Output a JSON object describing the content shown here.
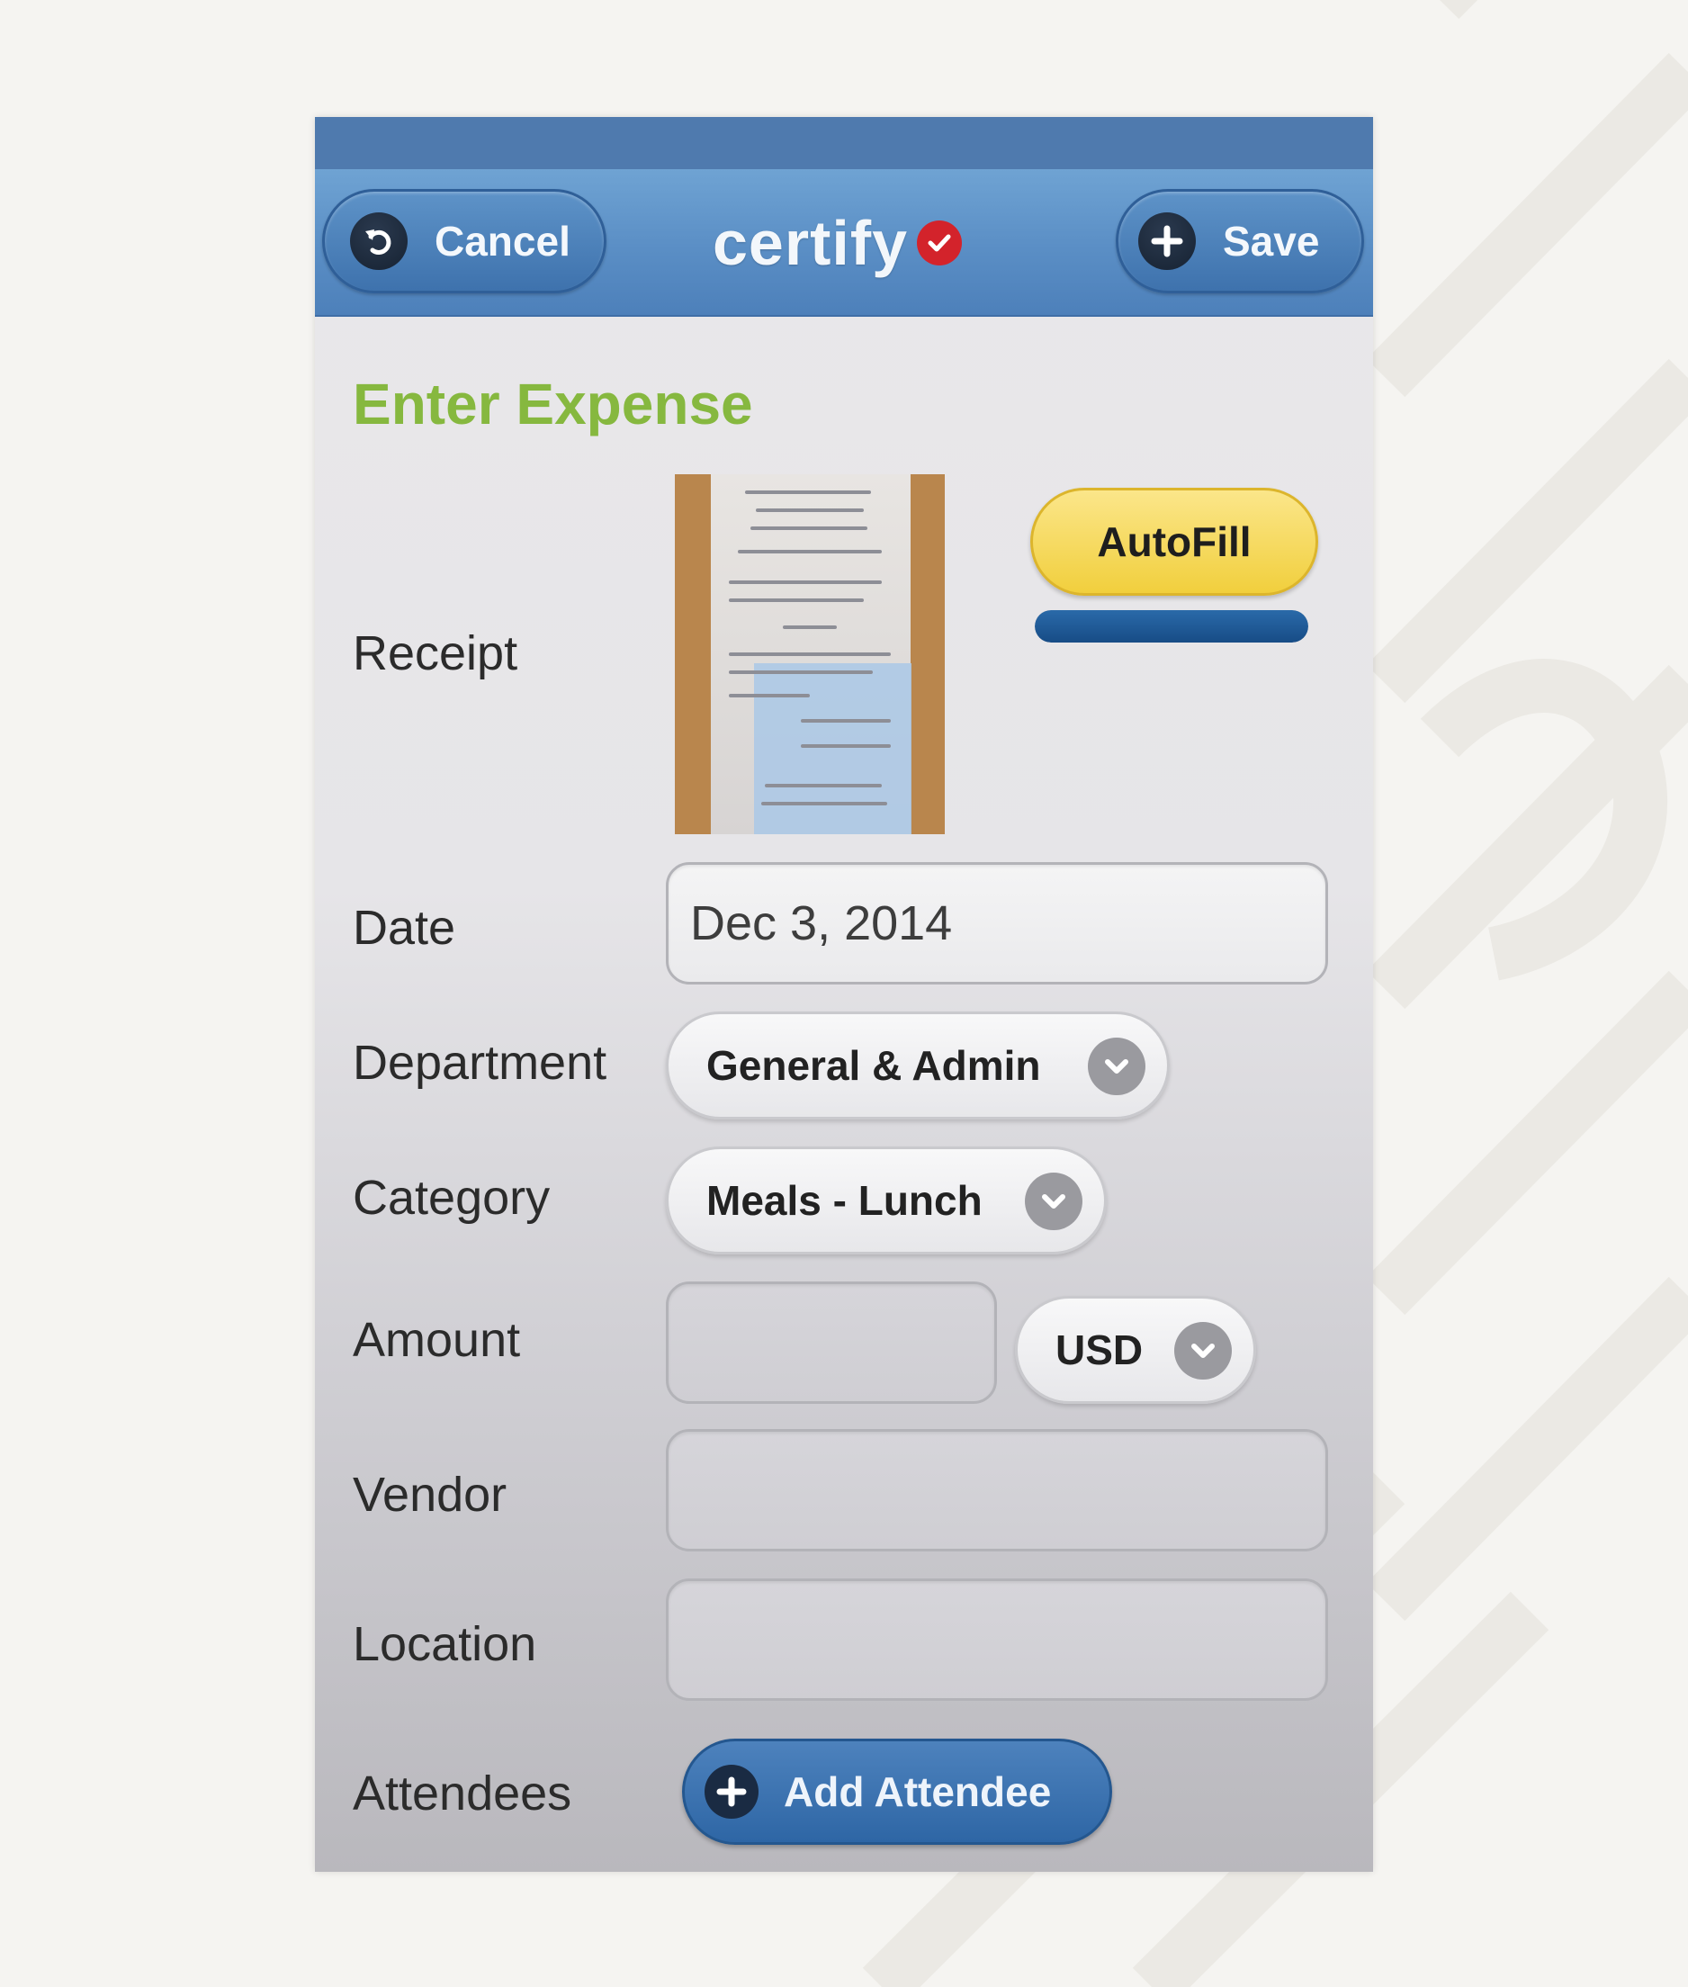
{
  "nav": {
    "cancel_label": "Cancel",
    "save_label": "Save",
    "brand": "certify",
    "cancel_icon": "undo-arrow-icon",
    "save_icon": "plus-icon",
    "brand_icon": "red-check-icon"
  },
  "form": {
    "heading": "Enter Expense",
    "receipt": {
      "label": "Receipt",
      "autofill_label": "AutoFill",
      "progress": 1.0
    },
    "date": {
      "label": "Date",
      "value": "Dec 3, 2014"
    },
    "department": {
      "label": "Department",
      "value": "General & Admin"
    },
    "category": {
      "label": "Category",
      "value": "Meals - Lunch"
    },
    "amount": {
      "label": "Amount",
      "value": "",
      "currency": "USD"
    },
    "vendor": {
      "label": "Vendor",
      "value": ""
    },
    "location": {
      "label": "Location",
      "value": ""
    },
    "attendees": {
      "label": "Attendees",
      "button_label": "Add Attendee"
    }
  },
  "colors": {
    "nav_blue": "#5a8ec5",
    "heading_green": "#86b83f",
    "autofill_yellow": "#f1cf3d",
    "progress_blue": "#174c86",
    "brand_check_red": "#d3232b"
  }
}
